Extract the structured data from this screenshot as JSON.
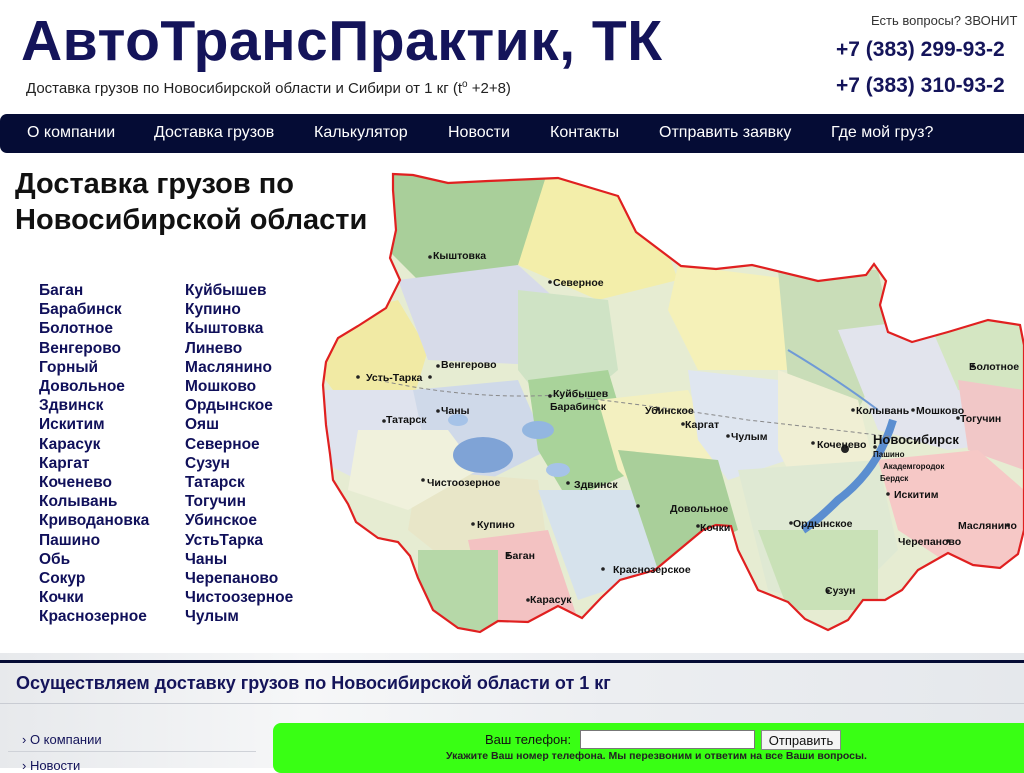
{
  "header": {
    "title": "АвтоТрансПрактик, ТК",
    "subtitle": "Доставка грузов по Новосибирской области и Сибири от 1 кг (t",
    "subtitle_sup": "o",
    "subtitle_tail": " +2+8)",
    "contact_prompt": "Есть вопросы? ЗВОНИТ",
    "phone1": "+7 (383) 299-93-2",
    "phone2": "+7 (383) 310-93-2"
  },
  "nav": {
    "items": [
      "О компании",
      "Доставка грузов",
      "Калькулятор",
      "Новости",
      "Контакты",
      "Отправить заявку",
      "Где мой груз?"
    ]
  },
  "main": {
    "heading_line1": "Доставка грузов по",
    "heading_line2": "Новосибирской области",
    "cities_col1": [
      "Баган",
      "Барабинск",
      "Болотное",
      "Венгерово",
      "Горный",
      "Довольное",
      "Здвинск",
      "Искитим",
      "Карасук",
      "Каргат",
      "Коченево",
      "Колывань",
      "Криводановка",
      "Пашино",
      "Обь",
      "Сокур",
      "Кочки",
      "Краснозерное"
    ],
    "cities_col2": [
      "Куйбышев",
      "Купино",
      "Кыштовка",
      "Линево",
      "Маслянино",
      "Мошково",
      "Ордынское",
      "Ояш",
      "Северное",
      "Сузун",
      "Татарск",
      "Тогучин",
      "Убинское",
      "УстьТарка",
      "Чаны",
      "Черепаново",
      "Чистоозерное",
      "Чулым"
    ]
  },
  "map": {
    "labels": {
      "kyshtovka": "Кыштовка",
      "severnoe": "Северное",
      "ust_tarka": "Усть-Тарка",
      "vengerovo": "Венгерово",
      "kuibyshev": "Куйбышев",
      "barabinsk": "Барабинск",
      "tatarsk": "Татарск",
      "chany": "Чаны",
      "ubinskoe": "Убинское",
      "kargat": "Каргат",
      "chulym": "Чулым",
      "kochenevo": "Коченево",
      "kolyvan": "Колывань",
      "moshkovo": "Мошково",
      "bolotnoe": "Болотное",
      "toguchin": "Тогучин",
      "novosibirsk": "Новосибирск",
      "pashino": "Пашино",
      "akademgorodok": "Академгородок",
      "berdsk": "Бердск",
      "iskitim": "Искитим",
      "chistoozernoe": "Чистоозерное",
      "zdvinsk": "Здвинск",
      "dovolnoe": "Довольное",
      "kochki": "Кочки",
      "ordynskoe": "Ордынское",
      "maslyanino": "Маслянино",
      "cherepanovo": "Черепаново",
      "kupino": "Купино",
      "bagan": "Баган",
      "krasnoozerskoe": "Краснозерское",
      "karasuk": "Карасук",
      "suzun": "Сузун"
    }
  },
  "banner": {
    "text": "Осуществляем доставку грузов по Новосибирской области от 1 кг"
  },
  "sidebar": {
    "links": [
      "› О компании",
      "› Новости"
    ]
  },
  "callback": {
    "label": "Ваш телефон:",
    "input_value": "",
    "button": "Отправить",
    "hint": "Укажите Ваш номер телефона. Мы перезвоним и ответим на все Ваши вопросы."
  },
  "colors": {
    "brand_dark": "#14145a",
    "nav_bg": "#050c35",
    "callback_bg": "#39ff14",
    "map_border": "#e02020"
  }
}
